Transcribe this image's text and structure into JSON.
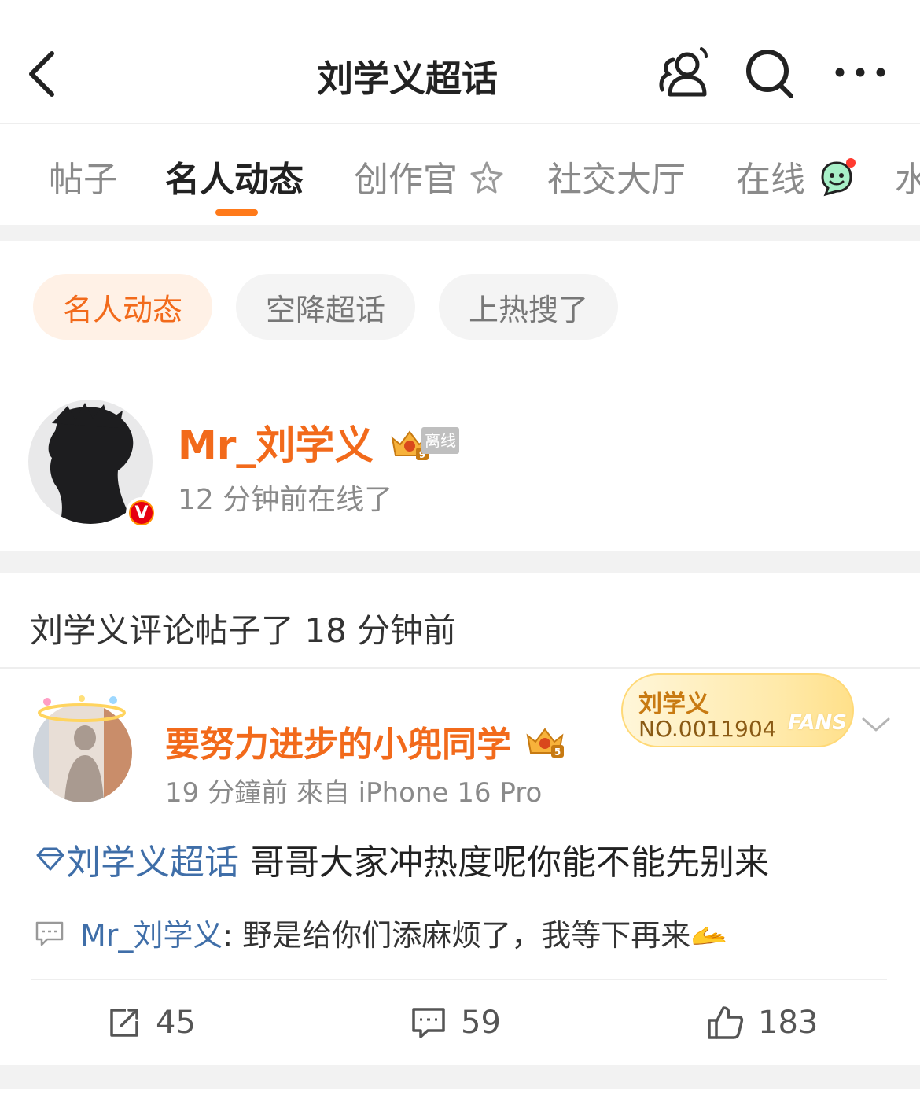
{
  "header": {
    "title": "刘学义超话"
  },
  "tabs": [
    {
      "label": "帖子"
    },
    {
      "label": "名人动态"
    },
    {
      "label": "创作官"
    },
    {
      "label": "社交大厅"
    },
    {
      "label": "在线"
    },
    {
      "label": "水"
    }
  ],
  "filters": [
    {
      "label": "名人动态"
    },
    {
      "label": "空降超话"
    },
    {
      "label": "上热搜了"
    }
  ],
  "celebrity": {
    "name": "Mr_刘学义",
    "badge_level": "9",
    "status_tag": "离线",
    "last_online": "12 分钟前在线了"
  },
  "activity": {
    "text": "刘学义评论帖子了 18 分钟前"
  },
  "post": {
    "author": "要努力进步的小兜同学",
    "author_badge_level": "5",
    "meta": "19 分鐘前   來自 iPhone 16 Pro",
    "fans_card": {
      "name": "刘学义",
      "number": "NO.0011904",
      "word": "FANS"
    },
    "topic": "刘学义超话",
    "body": "哥哥大家冲热度呢你能不能先别来",
    "reply": {
      "user": "Mr_刘学义",
      "text": ": 野是给你们添麻烦了，我等下再来",
      "emoji": "🫴"
    },
    "actions": {
      "reposts": "45",
      "comments": "59",
      "likes": "183"
    }
  },
  "colors": {
    "accent": "#f26a1b",
    "link": "#3f6ea8",
    "tab_underline": "#ff7a1a",
    "separator": "#f2f2f2"
  },
  "icons": [
    "back-icon",
    "friends-icon",
    "search-icon",
    "more-icon",
    "sparkle-icon",
    "smile-chat-icon",
    "crown-badge-icon",
    "diamond-topic-icon",
    "comment-icon",
    "repost-icon",
    "like-icon",
    "chevron-down-icon"
  ]
}
